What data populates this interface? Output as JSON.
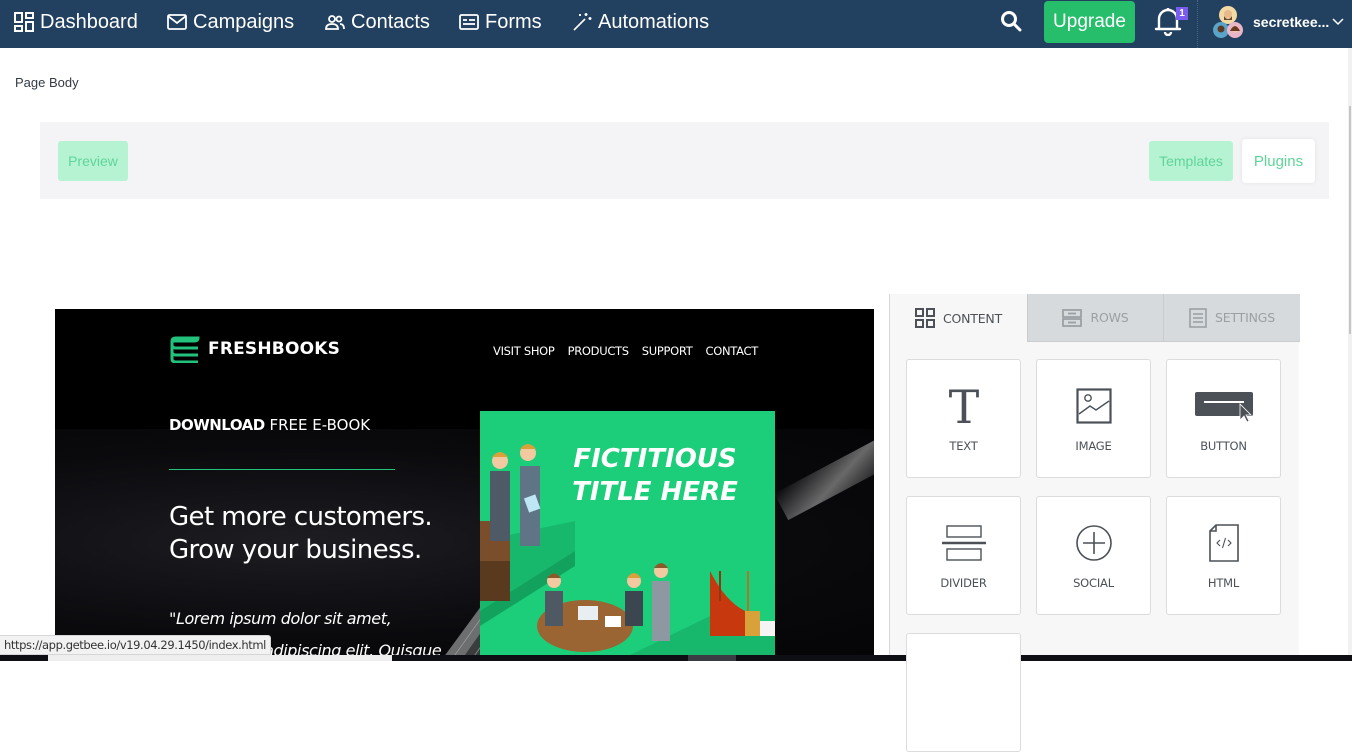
{
  "topnav": {
    "items": [
      {
        "label": "Dashboard",
        "icon": "dashboard-icon"
      },
      {
        "label": "Campaigns",
        "icon": "envelope-icon"
      },
      {
        "label": "Contacts",
        "icon": "contacts-icon"
      },
      {
        "label": "Forms",
        "icon": "form-icon"
      },
      {
        "label": "Automations",
        "icon": "magic-wand-icon"
      }
    ],
    "upgrade_label": "Upgrade",
    "notification_count": "1",
    "username": "secretkee...",
    "colors": {
      "bar": "#22405f",
      "upgrade": "#26bd6b",
      "badge": "#7b5cf0"
    }
  },
  "page": {
    "section_label": "Page Body"
  },
  "toolbar": {
    "preview_label": "Preview",
    "templates_label": "Templates",
    "plugins_label": "Plugins",
    "accent_color": "#5fd498"
  },
  "email": {
    "brand": "FRESHBOOKS",
    "nav": [
      "VISIT SHOP",
      "PRODUCTS",
      "SUPPORT",
      "CONTACT"
    ],
    "ebook_bold": "DOWNLOAD",
    "ebook_rest": " FREE E-BOOK",
    "headline_line1": "Get more customers.",
    "headline_line2": "Grow your business.",
    "quote_line1": "\"Lorem ipsum dolor sit amet,",
    "quote_line2": "consectetur adipiscing elit. Quisque",
    "promo_title_line1": "FICTITIOUS",
    "promo_title_line2": "TITLE HERE",
    "colors": {
      "accent": "#22c27d",
      "promo_bg": "#1ccd7a"
    }
  },
  "status_bar": {
    "url": "https://app.getbee.io/v19.04.29.1450/index.html"
  },
  "side_panel": {
    "tabs": [
      {
        "label": "CONTENT",
        "icon": "grid-icon",
        "active": true
      },
      {
        "label": "ROWS",
        "icon": "rows-icon",
        "active": false
      },
      {
        "label": "SETTINGS",
        "icon": "settings-doc-icon",
        "active": false
      }
    ],
    "blocks": [
      {
        "label": "TEXT",
        "icon": "text-icon"
      },
      {
        "label": "IMAGE",
        "icon": "image-icon"
      },
      {
        "label": "BUTTON",
        "icon": "button-icon"
      },
      {
        "label": "DIVIDER",
        "icon": "divider-icon"
      },
      {
        "label": "SOCIAL",
        "icon": "social-plus-icon"
      },
      {
        "label": "HTML",
        "icon": "html-file-icon"
      }
    ]
  }
}
